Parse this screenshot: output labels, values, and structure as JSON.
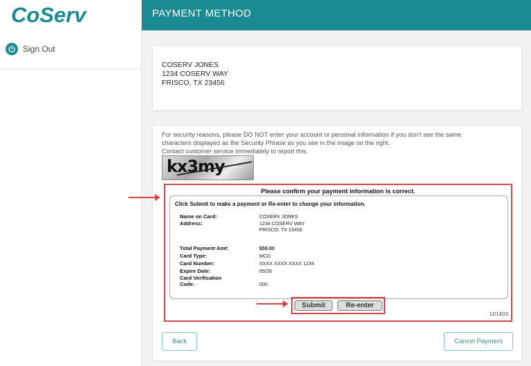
{
  "brand": {
    "logo_text": "CoServ",
    "primary_color": "#1a8a93",
    "highlight_color": "#d9434a"
  },
  "sidebar": {
    "signout_label": "Sign Out",
    "signout_icon": "power-icon"
  },
  "header": {
    "title": "PAYMENT METHOD"
  },
  "address": {
    "name": "COSERV JONES",
    "street": "1234 COSERV WAY",
    "city": "FRISCO, TX 23456"
  },
  "security": {
    "line1": "For security reasons, please DO NOT enter your account or personal information if you don't see the same",
    "line2": "characters displayed as the Security Phrase as you see in the image on the right.",
    "line3": "Contact customer service immediately to report this.",
    "captcha_text": "kx3my"
  },
  "confirm": {
    "title": "Please confirm your payment information is correct.",
    "instruction": "Click Submit to make a payment or Re-enter to change your information.",
    "fields": {
      "name_label": "Name on Card:",
      "name_value": "COSERV JONES",
      "address_label": "Address:",
      "address_line1": "1234 COSERV WAY",
      "address_line2": "FRISCO, TX 23456",
      "total_label": "Total Payment Amt:",
      "total_value": "$59.00",
      "card_type_label": "Card Type:",
      "card_type_value": "MCD",
      "card_number_label": "Card Number:",
      "card_number_value": "XXXX XXXX XXXX 1234",
      "expire_label": "Expire Date:",
      "expire_value": "05/28",
      "cvc_label_1": "Card Verification",
      "cvc_label_2": "Code:",
      "cvc_value": "000"
    },
    "submit_label": "Submit",
    "reenter_label": "Re-enter",
    "date": "12/13/23"
  },
  "footer": {
    "back_label": "Back",
    "cancel_label": "Cancel Payment"
  }
}
